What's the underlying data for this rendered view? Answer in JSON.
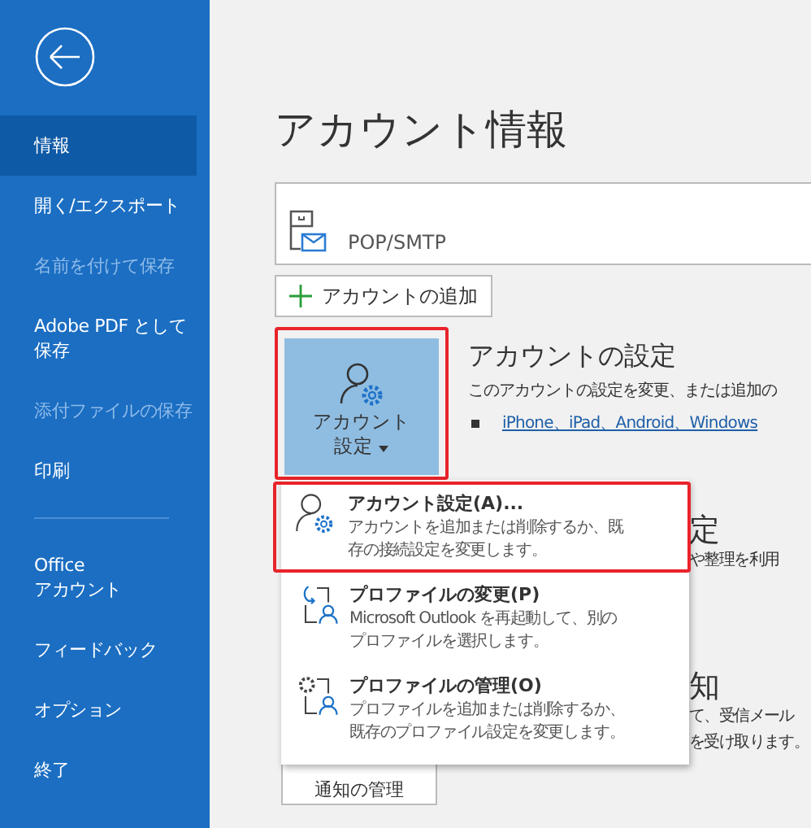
{
  "sidebar": {
    "items": [
      {
        "label": "情報",
        "selected": true,
        "disabled": false
      },
      {
        "label": "開く/エクスポート",
        "selected": false,
        "disabled": false
      },
      {
        "label": "名前を付けて保存",
        "selected": false,
        "disabled": true
      },
      {
        "label": "Adobe PDF として保存",
        "selected": false,
        "disabled": false
      },
      {
        "label": "添付ファイルの保存",
        "selected": false,
        "disabled": true
      },
      {
        "label": "印刷",
        "selected": false,
        "disabled": false
      },
      {
        "label": "Office\nアカウント",
        "selected": false,
        "disabled": false,
        "divider_before": true
      },
      {
        "label": "フィードバック",
        "selected": false,
        "disabled": false
      },
      {
        "label": "オプション",
        "selected": false,
        "disabled": false
      },
      {
        "label": "終了",
        "selected": false,
        "disabled": false
      }
    ]
  },
  "title": "アカウント情報",
  "account": {
    "type": "POP/SMTP"
  },
  "add_account_button": "アカウントの追加",
  "account_settings": {
    "tile_label_1": "アカウント",
    "tile_label_2": "設定",
    "heading": "アカウントの設定",
    "description": "このアカウントの設定を変更、または追加の",
    "link": "iPhone、iPad、Android、Windows"
  },
  "dropdown": [
    {
      "kind": "account",
      "title": "アカウント設定(A)...",
      "description": "アカウントを追加または削除するか、既存の接続設定を変更します。",
      "highlighted": true
    },
    {
      "kind": "change",
      "title": "プロファイルの変更(P)",
      "description": "Microsoft Outlook を再起動して、別のプロファイルを選択します。",
      "highlighted": false
    },
    {
      "kind": "manage",
      "title": "プロファイルの管理(O)",
      "description": "プロファイルを追加または削除するか、既存のプロファイル設定を変更します。",
      "highlighted": false
    }
  ],
  "behind_menu": {
    "heading_1": "定",
    "text_1": "や整理を利用",
    "heading_2": "知",
    "text_2": "て、受信メール",
    "text_3": "を受け取ります。",
    "button": "通知の管理"
  }
}
